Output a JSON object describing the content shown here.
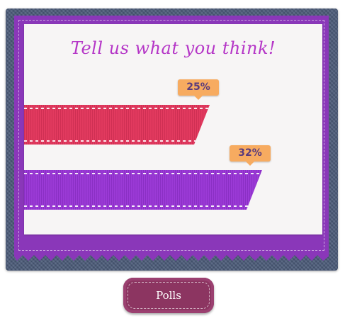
{
  "poll": {
    "title": "Tell us what you think!",
    "options": [
      {
        "percent_label": "25%",
        "value": 25,
        "color": "#e23a5f"
      },
      {
        "percent_label": "32%",
        "value": 32,
        "color": "#9b3ad6"
      }
    ]
  },
  "button": {
    "label": "Polls"
  },
  "colors": {
    "denim": "#4c5c7a",
    "frame": "#8a37b9",
    "card": "#f7f5f5",
    "title": "#b536c7",
    "tooltip": "#f7ab60",
    "button": "#8c3561"
  }
}
